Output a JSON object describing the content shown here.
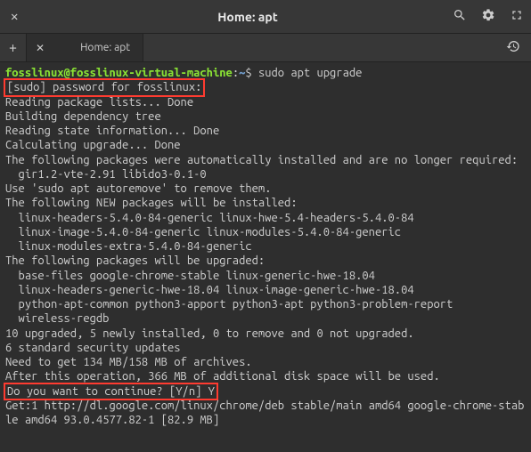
{
  "titlebar": {
    "title": "Home: apt"
  },
  "tab": {
    "label": "Home: apt"
  },
  "prompt": {
    "userhost": "fosslinux@fosslinux-virtual-machine",
    "colon": ":",
    "path": "~",
    "dollar": "$",
    "command": "sudo apt upgrade"
  },
  "lines": {
    "pw": "[sudo] password for fosslinux:",
    "l1": "Reading package lists... Done",
    "l2": "Building dependency tree",
    "l3": "Reading state information... Done",
    "l4": "Calculating upgrade... Done",
    "l5": "The following packages were automatically installed and are no longer required:",
    "l6": "gir1.2-vte-2.91 libido3-0.1-0",
    "l7": "Use 'sudo apt autoremove' to remove them.",
    "l8": "The following NEW packages will be installed:",
    "l9": "linux-headers-5.4.0-84-generic linux-hwe-5.4-headers-5.4.0-84",
    "l10": "linux-image-5.4.0-84-generic linux-modules-5.4.0-84-generic",
    "l11": "linux-modules-extra-5.4.0-84-generic",
    "l12": "The following packages will be upgraded:",
    "l13": "base-files google-chrome-stable linux-generic-hwe-18.04",
    "l14": "linux-headers-generic-hwe-18.04 linux-image-generic-hwe-18.04",
    "l15": "python-apt-common python3-apport python3-apt python3-problem-report",
    "l16": "wireless-regdb",
    "l17": "10 upgraded, 5 newly installed, 0 to remove and 0 not upgraded.",
    "l18": "6 standard security updates",
    "l19": "Need to get 134 MB/158 MB of archives.",
    "l20": "After this operation, 366 MB of additional disk space will be used.",
    "l21": "Do you want to continue? [Y/n] Y",
    "l22": "Get:1 http://dl.google.com/linux/chrome/deb stable/main amd64 google-chrome-stable amd64 93.0.4577.82-1 [82.9 MB]"
  }
}
